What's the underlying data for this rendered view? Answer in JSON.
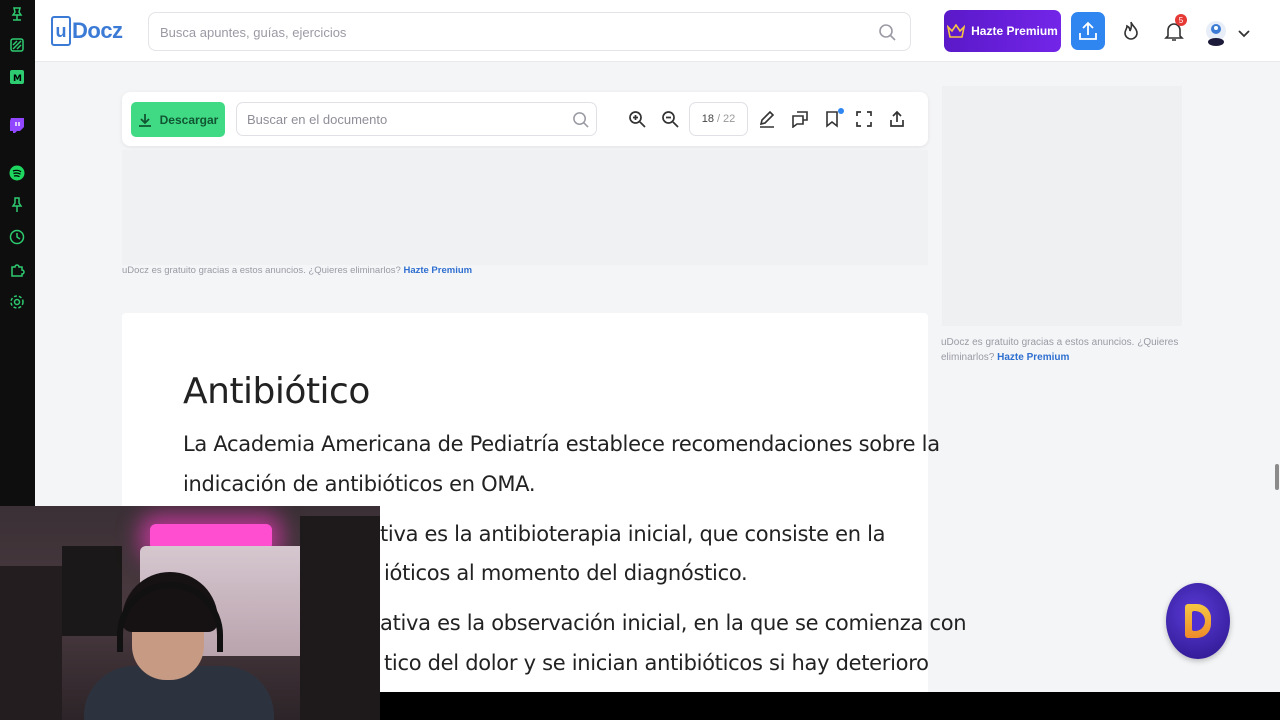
{
  "header": {
    "logo_text": "Docz",
    "logo_letter": "u",
    "search_placeholder": "Busca apuntes, guías, ejercicios",
    "premium_label": "Hazte Premium",
    "notification_count": "5"
  },
  "toolbar": {
    "download_label": "Descargar",
    "doc_search_placeholder": "Buscar en el documento",
    "page_current": "18",
    "page_total": "22"
  },
  "ads": {
    "note_text": "uDocz es gratuito gracias a estos anuncios. ¿Quieres eliminarlos?",
    "note_link": "Hazte Premium",
    "side_note_text": "uDocz es gratuito gracias a estos anuncios. ¿Quieres eliminarlos?",
    "side_note_link": "Hazte Premium"
  },
  "document": {
    "title": "Antibiótico",
    "line1": "La Academia Americana de Pediatría establece recomendaciones sobre la",
    "line2": "indicación de antibióticos en OMA.",
    "line3": "tiva es la antibioterapia inicial, que consiste en la",
    "line4": "ióticos al momento del diagnóstico.",
    "line5": "ativa es la observación inicial, en la que se comienza con",
    "line6": "tico del dolor y se inician antibióticos si hay deterioro"
  },
  "colors": {
    "brand": "#3b7bd6",
    "premium": "#6a1fe0",
    "download": "#3fda83",
    "upload": "#2f86f0",
    "sidebar_icons": "#2ecc71"
  },
  "sidebar_icons": [
    "pin-icon",
    "layers-icon",
    "m-app-icon",
    "twitch-icon",
    "spotify-icon",
    "pushpin-icon",
    "clock-icon",
    "puzzle-icon",
    "settings-icon"
  ]
}
